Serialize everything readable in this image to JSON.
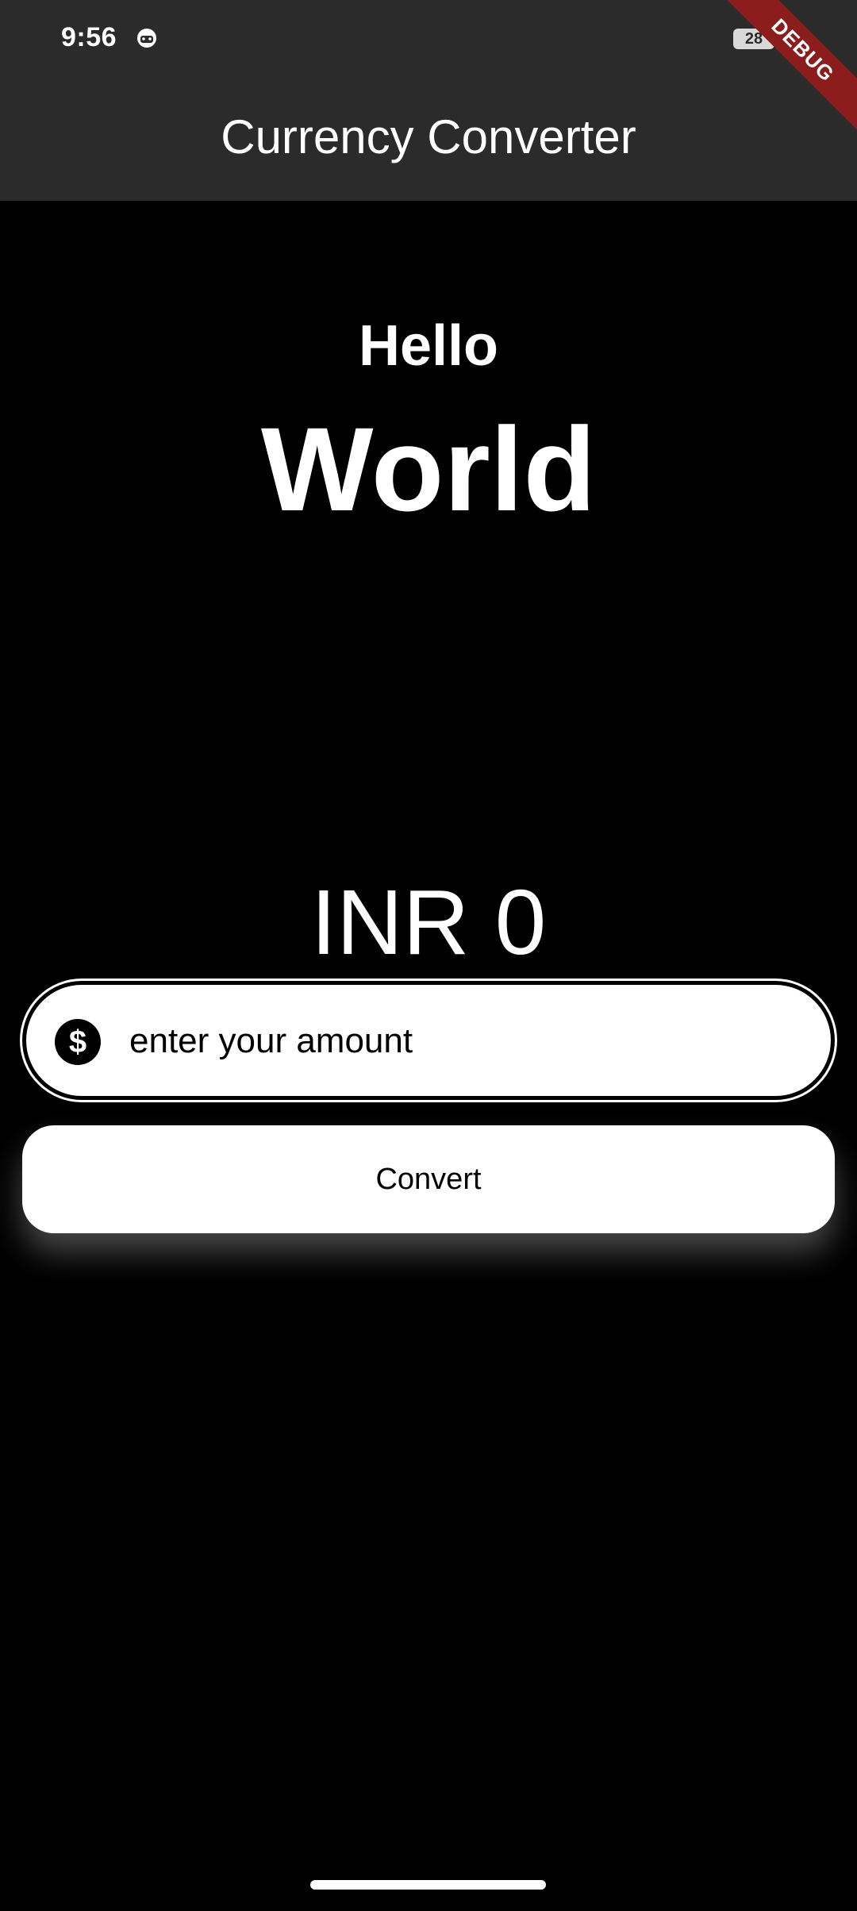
{
  "status_bar": {
    "time": "9:56",
    "app_icon": "android-face-icon",
    "battery": "28"
  },
  "app_bar": {
    "title": "Currency Converter"
  },
  "debug_banner": {
    "label": "DEBUG",
    "color": "#8b1d1d"
  },
  "main": {
    "hello_text": "Hello",
    "world_text": "World",
    "result_text": "INR 0",
    "amount_field": {
      "icon": "dollar-circle-icon",
      "placeholder": "enter your amount",
      "value": ""
    },
    "convert_label": "Convert"
  },
  "colors": {
    "background": "#000000",
    "app_bar": "#2b2b2b",
    "surface": "#ffffff"
  }
}
